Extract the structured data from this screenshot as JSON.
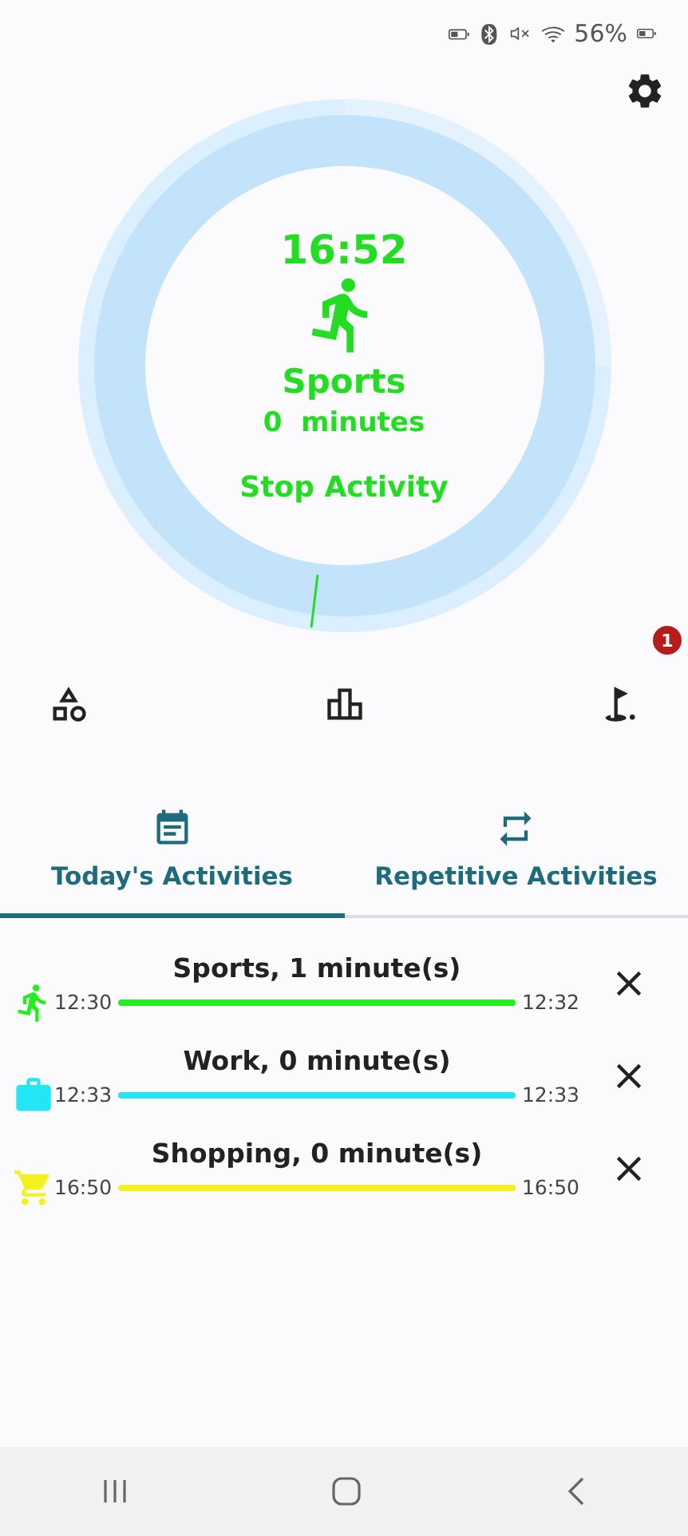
{
  "status_bar": {
    "battery": "56%"
  },
  "timer": {
    "time": "16:52",
    "activity": "Sports",
    "duration": "0  minutes",
    "action": "Stop Activity"
  },
  "notification_badge": "1",
  "tabs": [
    {
      "label": "Today's Activities",
      "selected": true,
      "kind": "calendar"
    },
    {
      "label": "Repetitive Activities",
      "selected": false,
      "kind": "repeat"
    }
  ],
  "activities": [
    {
      "title": "Sports, 1 minute(s)",
      "start": "12:30",
      "end": "12:32",
      "kind": "run",
      "color": "#22ee22"
    },
    {
      "title": "Work, 0 minute(s)",
      "start": "12:33",
      "end": "12:33",
      "kind": "work",
      "color": "#22e6f5"
    },
    {
      "title": "Shopping, 0 minute(s)",
      "start": "16:50",
      "end": "16:50",
      "kind": "cart",
      "color": "#f5f020"
    }
  ]
}
